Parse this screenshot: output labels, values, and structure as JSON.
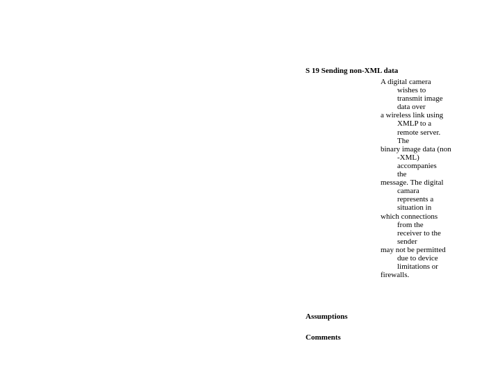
{
  "heading": "S 19 Sending non-XML data",
  "desc": {
    "l1": "A digital camera",
    "l2": "wishes to",
    "l3": "transmit image",
    "l4": "data over",
    "l5": "a wireless link using",
    "l6": "XMLP to a",
    "l7": "remote server.",
    "l8": "The",
    "l9": "binary image data (non",
    "l10": "-XML)",
    "l11": "accompanies",
    "l12": "the",
    "l13": "message. The digital",
    "l14": "camara",
    "l15": "represents a",
    "l16": "situation in",
    "l17": "which connections",
    "l18": "from the",
    "l19": "receiver to the",
    "l20": "sender",
    "l21": "may not be permitted",
    "l22": "due to device",
    "l23": "limitations or",
    "l24": "firewalls."
  },
  "assumptions_label": "Assumptions",
  "comments_label": "Comments"
}
